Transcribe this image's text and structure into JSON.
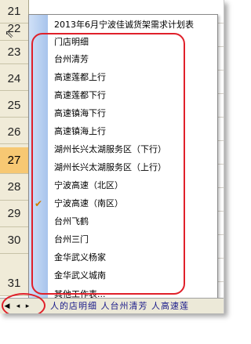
{
  "row_headers": [
    "21",
    "22",
    "23",
    "24",
    "25",
    "26",
    "27",
    "28",
    "29",
    "30",
    "31"
  ],
  "active_row": "27",
  "menu": {
    "items": [
      {
        "label": "2013年6月宁波佳诚货架需求计划表",
        "checked": false
      },
      {
        "label": "门店明细",
        "checked": false
      },
      {
        "label": "台州清芳",
        "checked": false
      },
      {
        "label": "高速莲都上行",
        "checked": false
      },
      {
        "label": "高速莲都下行",
        "checked": false
      },
      {
        "label": "高速镇海下行",
        "checked": false
      },
      {
        "label": "高速镇海上行",
        "checked": false
      },
      {
        "label": "湖州长兴太湖服务区（下行）",
        "checked": false
      },
      {
        "label": "湖州长兴太湖服务区（上行）",
        "checked": false
      },
      {
        "label": "宁波高速（北区）",
        "checked": false
      },
      {
        "label": "宁波高速（南区）",
        "checked": true
      },
      {
        "label": "台州飞鹤",
        "checked": false
      },
      {
        "label": "台州三门",
        "checked": false
      },
      {
        "label": "金华武义杨家",
        "checked": false
      },
      {
        "label": "金华武义城南",
        "checked": false
      },
      {
        "label": "其他工作表...",
        "checked": false
      }
    ],
    "check_glyph": "✔"
  },
  "tabbar": {
    "nav_first": "◀",
    "nav_prev": "◂",
    "nav_next": "▸",
    "sheet_tabs_partial": "人的店明细 人台州清芳 人高速莲"
  },
  "colors": {
    "annotation": "#e0202a",
    "check": "#d07a00",
    "active_row": "#f7c873"
  }
}
